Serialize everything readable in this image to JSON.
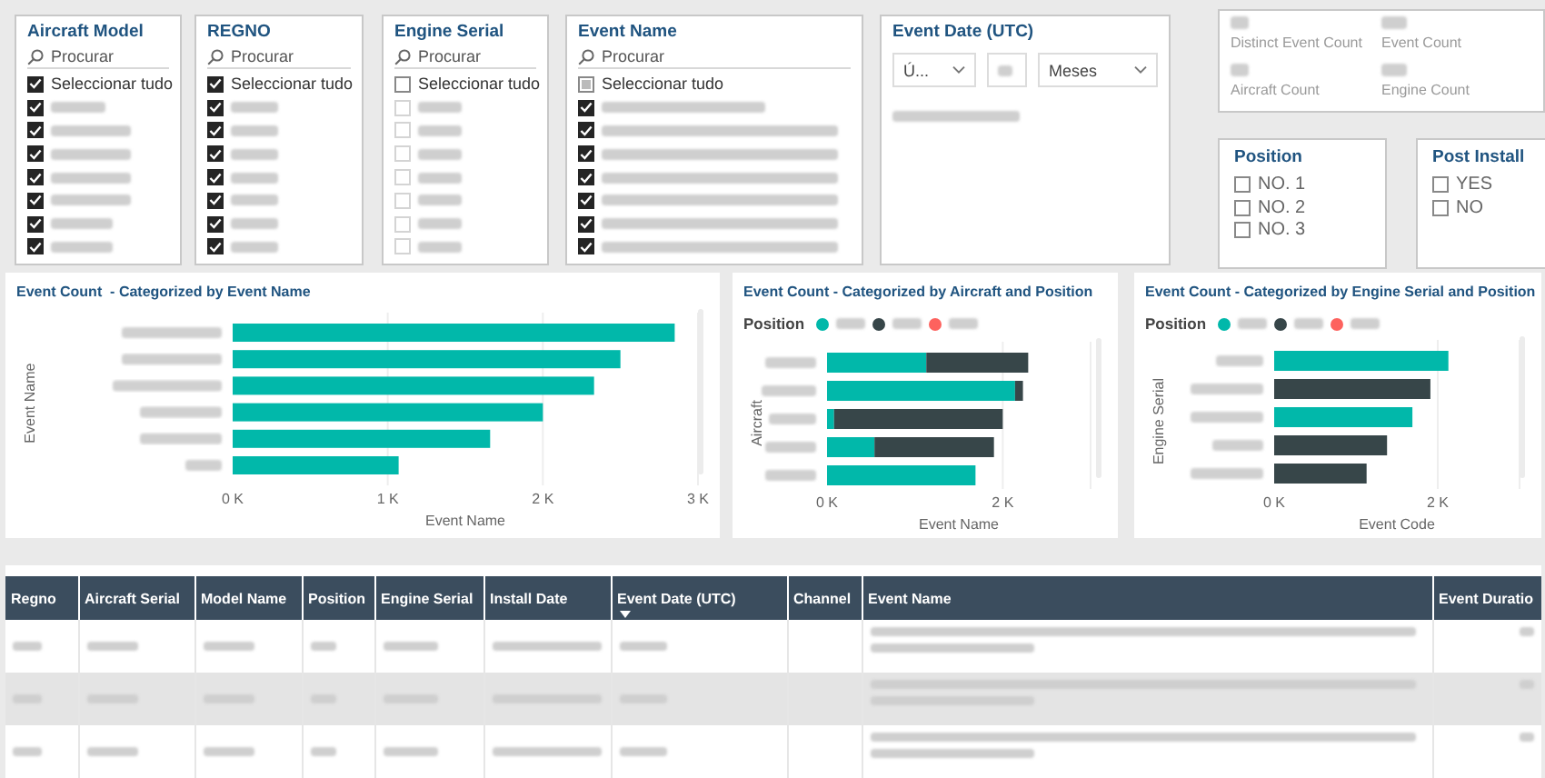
{
  "slicers": [
    {
      "title": "Aircraft Model",
      "search_placeholder": "Procurar",
      "select_all": {
        "label": "Seleccionar tudo",
        "checked": true
      },
      "items": [
        {
          "checked": true
        },
        {
          "checked": true
        },
        {
          "checked": true
        },
        {
          "checked": true
        },
        {
          "checked": true
        },
        {
          "checked": true
        },
        {
          "checked": true
        }
      ]
    },
    {
      "title": "REGNO",
      "search_placeholder": "Procurar",
      "select_all": {
        "label": "Seleccionar tudo",
        "checked": true
      },
      "items": [
        {
          "checked": true
        },
        {
          "checked": true
        },
        {
          "checked": true
        },
        {
          "checked": true
        },
        {
          "checked": true
        },
        {
          "checked": true
        },
        {
          "checked": true
        }
      ]
    },
    {
      "title": "Engine Serial",
      "search_placeholder": "Procurar",
      "select_all": {
        "label": "Seleccionar tudo",
        "checked": false
      },
      "items": [
        {
          "checked": false
        },
        {
          "checked": false
        },
        {
          "checked": false
        },
        {
          "checked": false
        },
        {
          "checked": false
        },
        {
          "checked": false
        },
        {
          "checked": false
        }
      ]
    },
    {
      "title": "Event Name",
      "search_placeholder": "Procurar",
      "select_all": {
        "label": "Seleccionar tudo",
        "checked": false,
        "partial": true
      },
      "items": [
        {
          "checked": true
        },
        {
          "checked": true
        },
        {
          "checked": true
        },
        {
          "checked": true
        },
        {
          "checked": true
        },
        {
          "checked": true
        },
        {
          "checked": true
        }
      ]
    }
  ],
  "date_slicer": {
    "title": "Event Date (UTC)",
    "period_dropdown": "Ú...",
    "unit_dropdown": "Meses"
  },
  "kpi_card": {
    "metrics": [
      {
        "label": "Distinct Event Count"
      },
      {
        "label": "Event Count"
      },
      {
        "label": "Aircraft Count"
      },
      {
        "label": "Engine Count"
      }
    ]
  },
  "option_slicers": [
    {
      "title": "Position",
      "options": [
        {
          "label": "NO. 1",
          "checked": false
        },
        {
          "label": "NO. 2",
          "checked": false
        },
        {
          "label": "NO. 3",
          "checked": false
        }
      ]
    },
    {
      "title": "Post Install",
      "options": [
        {
          "label": "YES",
          "checked": false
        },
        {
          "label": "NO",
          "checked": false
        }
      ]
    }
  ],
  "charts": [
    {
      "title": "Event Count  - Categorized by Event Name",
      "chart_data": {
        "type": "bar",
        "orientation": "horizontal",
        "xlabel": "Event Name",
        "ylabel": "Event Name",
        "values": [
          2850,
          2500,
          2330,
          2000,
          1660,
          1070
        ],
        "xlim": [
          0,
          3000
        ],
        "xticks": [
          {
            "value": 0,
            "label": "0 K"
          },
          {
            "value": 1000,
            "label": "1 K"
          },
          {
            "value": 2000,
            "label": "2 K"
          },
          {
            "value": 3000,
            "label": "3 K"
          }
        ]
      }
    },
    {
      "title": "Event Count - Categorized by Aircraft and Position",
      "legend_title": "Position",
      "chart_data": {
        "type": "bar",
        "orientation": "horizontal",
        "stacked": true,
        "xlabel": "Event Name",
        "ylabel": "Aircraft",
        "xlim": [
          0,
          3000
        ],
        "xticks": [
          {
            "value": 0,
            "label": "0 K"
          },
          {
            "value": 2000,
            "label": "2 K"
          }
        ],
        "series": [
          {
            "color": "#01b8aa",
            "values": [
              1130,
              2140,
              80,
              540,
              1690
            ]
          },
          {
            "color": "#374649",
            "values": [
              1160,
              90,
              1920,
              1360,
              null
            ]
          },
          {
            "color": "#fd625e",
            "values": [
              null,
              null,
              null,
              null,
              null
            ]
          }
        ]
      }
    },
    {
      "title": "Event Count - Categorized by Engine Serial and Position",
      "legend_title": "Position",
      "chart_data": {
        "type": "bar",
        "orientation": "horizontal",
        "stacked": true,
        "xlabel": "Event Code",
        "ylabel": "Engine Serial",
        "xlim": [
          0,
          3000
        ],
        "xticks": [
          {
            "value": 0,
            "label": "0 K"
          },
          {
            "value": 2000,
            "label": "2 K"
          }
        ],
        "series": [
          {
            "color": "#01b8aa",
            "values": [
              2130,
              null,
              1690,
              null,
              null
            ]
          },
          {
            "color": "#374649",
            "values": [
              null,
              1910,
              null,
              1380,
              1130
            ]
          },
          {
            "color": "#fd625e",
            "values": [
              null,
              null,
              null,
              null,
              null
            ]
          }
        ]
      }
    }
  ],
  "table": {
    "columns": [
      {
        "label": "Regno",
        "sorted": false
      },
      {
        "label": "Aircraft Serial",
        "sorted": false
      },
      {
        "label": "Model Name",
        "sorted": false
      },
      {
        "label": "Position",
        "sorted": false
      },
      {
        "label": "Engine Serial",
        "sorted": false
      },
      {
        "label": "Install Date",
        "sorted": false
      },
      {
        "label": "Event Date (UTC)",
        "sorted": true
      },
      {
        "label": "Channel",
        "sorted": false
      },
      {
        "label": "Event Name",
        "sorted": false
      },
      {
        "label": "Event Duratio",
        "sorted": false
      }
    ],
    "rows": [
      {
        "striped": false
      },
      {
        "striped": true
      },
      {
        "striped": false
      }
    ]
  }
}
